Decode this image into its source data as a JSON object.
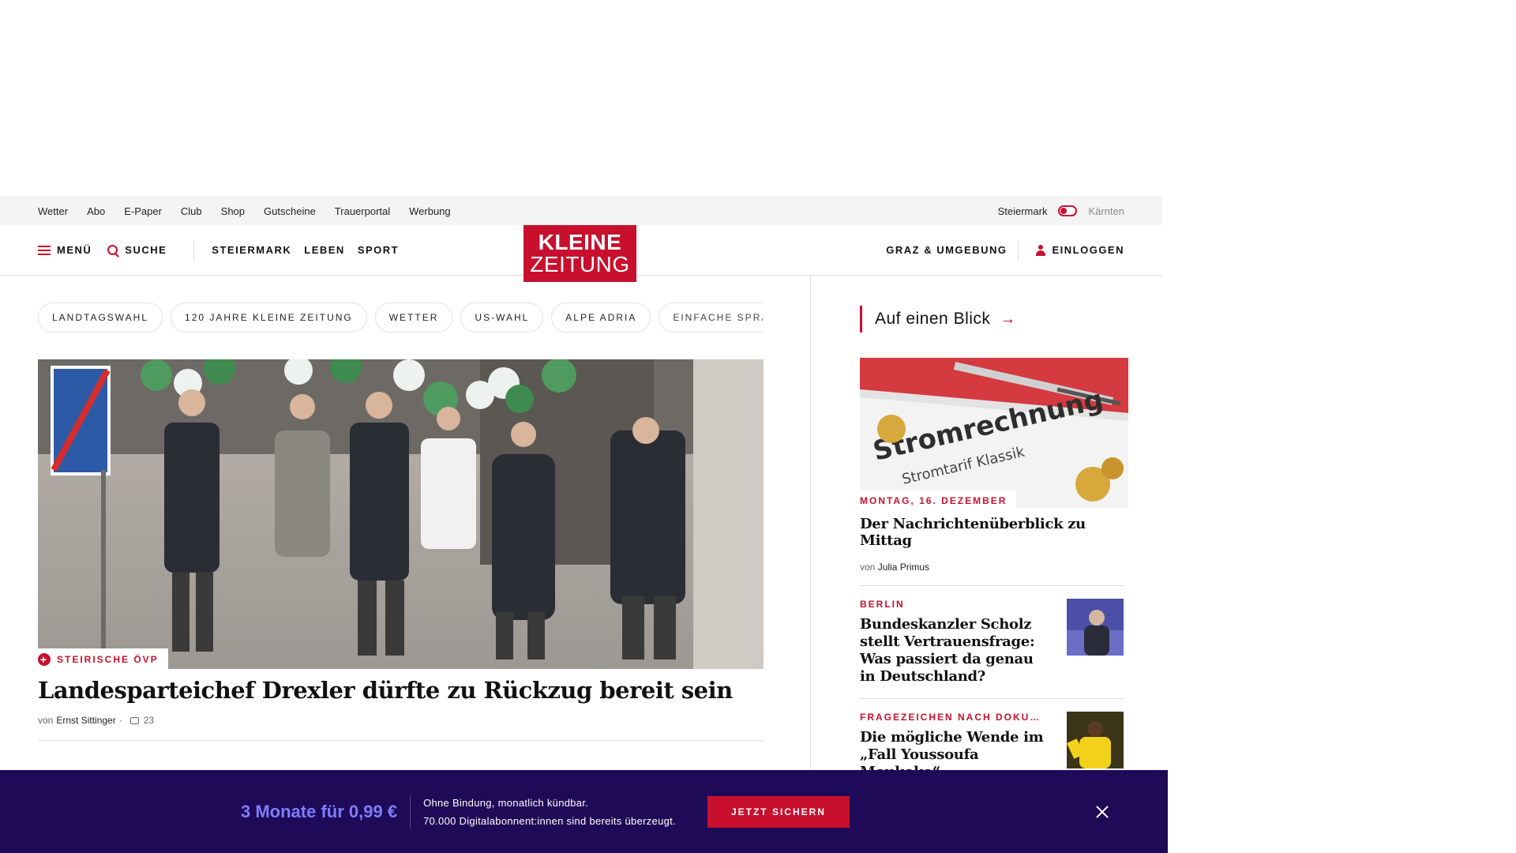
{
  "topbar": {
    "links": [
      "Wetter",
      "Abo",
      "E-Paper",
      "Club",
      "Shop",
      "Gutscheine",
      "Trauerportal",
      "Werbung"
    ],
    "region_active": "Steiermark",
    "region_inactive": "Kärnten"
  },
  "nav": {
    "menu_label": "MENÜ",
    "search_label": "SUCHE",
    "sections": [
      "STEIERMARK",
      "LEBEN",
      "SPORT"
    ],
    "logo_line1": "KLEINE",
    "logo_line2": "ZEITUNG",
    "location": "GRAZ & UMGEBUNG",
    "login_label": "EINLOGGEN"
  },
  "chips": [
    "LANDTAGSWAHL",
    "120 JAHRE KLEINE ZEITUNG",
    "WETTER",
    "US-WAHL",
    "ALPE ADRIA",
    "EINFACHE SPRACHE"
  ],
  "lead": {
    "kicker": "STEIRISCHE ÖVP",
    "headline": "Landesparteichef Drexler dürfte zu Rückzug bereit sein",
    "byline_prefix": "von",
    "author": "Ernst Sittinger",
    "comments": "23"
  },
  "sidebar": {
    "title": "Auf einen Blick",
    "top": {
      "date": "MONTAG, 16. DEZEMBER",
      "headline": "Der Nachrichtenüberblick zu Mittag",
      "byline_prefix": "von",
      "author": "Julia Primus"
    },
    "teasers": [
      {
        "kicker": "BERLIN",
        "title": "Bundeskanzler Scholz stellt Vertrauensfrage: Was passiert da genau in Deutschland?"
      },
      {
        "kicker": "FRAGEZEICHEN NACH DOKU…",
        "title": "Die mögliche Wende im „Fall Youssoufa Moukoko“"
      }
    ]
  },
  "promo": {
    "price": "3 Monate für 0,99 €",
    "line1": "Ohne Bindung, monatlich kündbar.",
    "line2": "70.000 Digitalabonnent:innen sind bereits überzeugt.",
    "cta": "JETZT SICHERN"
  },
  "colors": {
    "brand": "#c8102e",
    "promo_bg": "#1f0a57",
    "promo_price": "#7d7dff"
  },
  "icons": [
    "hamburger-icon",
    "search-icon",
    "user-icon",
    "arrow-right-icon",
    "chevron-right-icon",
    "comment-icon",
    "plus-icon",
    "close-icon"
  ]
}
